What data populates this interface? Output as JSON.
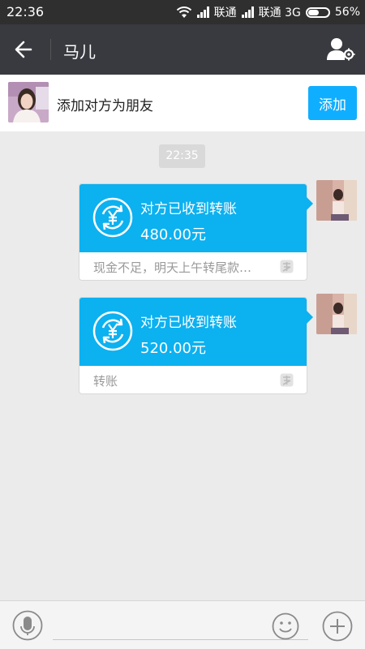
{
  "statusbar": {
    "time": "22:36",
    "carrier1": "联通",
    "carrier2": "联通 3G",
    "battery": "56%",
    "battery_level": 0.56
  },
  "header": {
    "title": "马儿",
    "back_icon": "back-arrow-icon",
    "profile_icon": "user-settings-icon"
  },
  "add_friend": {
    "text": "添加对方为朋友",
    "button": "添加"
  },
  "chat": {
    "timestamp": "22:35",
    "messages": [
      {
        "status": "对方已收到转账",
        "amount": "480.00元",
        "note": "现金不足，明天上午转尾款…",
        "icon": "transfer-yuan-icon"
      },
      {
        "status": "对方已收到转账",
        "amount": "520.00元",
        "note": "转账",
        "icon": "transfer-yuan-icon"
      }
    ]
  },
  "input": {
    "voice_icon": "microphone-icon",
    "emoji_icon": "smiley-icon",
    "plus_icon": "plus-icon",
    "placeholder": ""
  },
  "colors": {
    "accent": "#10aeff",
    "card_blue": "#0cb1f0",
    "header": "#393a3f",
    "statusbar": "#2f2f2f",
    "background": "#ebebeb"
  }
}
